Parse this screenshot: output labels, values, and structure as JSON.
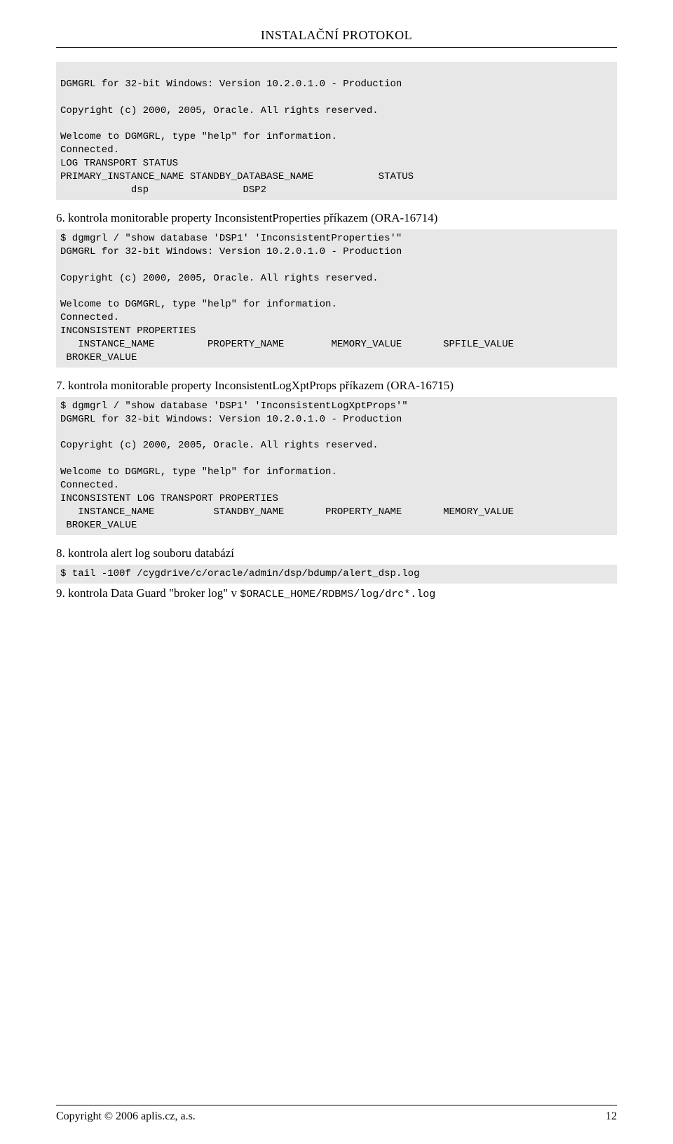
{
  "header": {
    "title": "INSTALAČNÍ PROTOKOL"
  },
  "blocks": {
    "code1": "\nDGMGRL for 32-bit Windows: Version 10.2.0.1.0 - Production\n\nCopyright (c) 2000, 2005, Oracle. All rights reserved.\n\nWelcome to DGMGRL, type \"help\" for information.\nConnected.\nLOG TRANSPORT STATUS\nPRIMARY_INSTANCE_NAME STANDBY_DATABASE_NAME           STATUS\n            dsp                DSP2\n",
    "item6": "6. kontrola monitorable property InconsistentProperties příkazem (ORA-16714)",
    "code2": "$ dgmgrl / \"show database 'DSP1' 'InconsistentProperties'\"\nDGMGRL for 32-bit Windows: Version 10.2.0.1.0 - Production\n\nCopyright (c) 2000, 2005, Oracle. All rights reserved.\n\nWelcome to DGMGRL, type \"help\" for information.\nConnected.\nINCONSISTENT PROPERTIES\n   INSTANCE_NAME         PROPERTY_NAME        MEMORY_VALUE       SPFILE_VALUE\n BROKER_VALUE",
    "item7": "7. kontrola monitorable property InconsistentLogXptProps příkazem (ORA-16715)",
    "code3": "$ dgmgrl / \"show database 'DSP1' 'InconsistentLogXptProps'\"\nDGMGRL for 32-bit Windows: Version 10.2.0.1.0 - Production\n\nCopyright (c) 2000, 2005, Oracle. All rights reserved.\n\nWelcome to DGMGRL, type \"help\" for information.\nConnected.\nINCONSISTENT LOG TRANSPORT PROPERTIES\n   INSTANCE_NAME          STANDBY_NAME       PROPERTY_NAME       MEMORY_VALUE\n BROKER_VALUE",
    "item8": "8. kontrola alert log souboru databází",
    "code4": "$ tail -100f /cygdrive/c/oracle/admin/dsp/bdump/alert_dsp.log",
    "item9_prefix": "9. kontrola Data Guard \"broker log\" v ",
    "item9_path": "$ORACLE_HOME/RDBMS/log/drc*.log"
  },
  "footer": {
    "copyright": "Copyright © 2006 aplis.cz, a.s.",
    "page": "12"
  }
}
